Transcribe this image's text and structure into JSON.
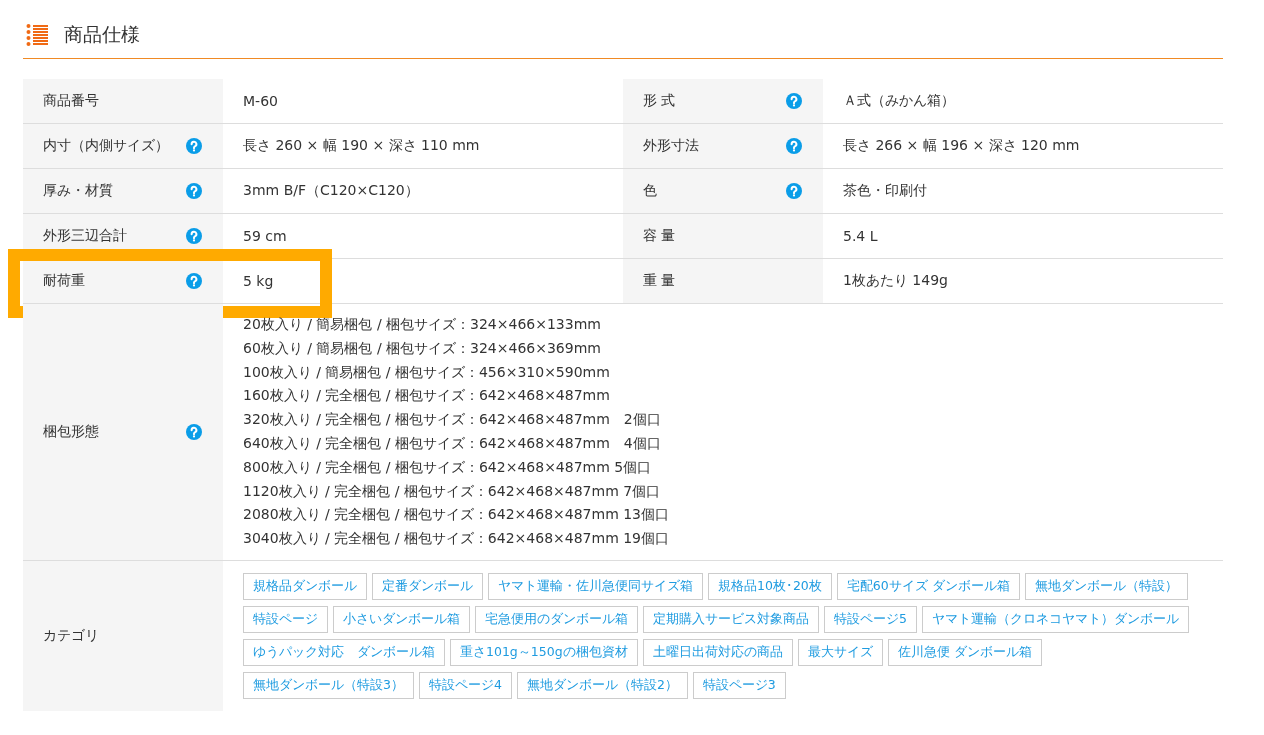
{
  "section": {
    "title": "商品仕様"
  },
  "rows": [
    {
      "cells": [
        {
          "label": "商品番号",
          "help": false,
          "value": "M-60"
        },
        {
          "label": "形 式",
          "help": true,
          "value": "Ａ式（みかん箱）"
        }
      ]
    },
    {
      "cells": [
        {
          "label": "内寸（内側サイズ）",
          "help": true,
          "value": "長さ 260 × 幅 190 × 深さ 110 mm"
        },
        {
          "label": "外形寸法",
          "help": true,
          "value": "長さ 266 × 幅 196 × 深さ 120 mm"
        }
      ]
    },
    {
      "cells": [
        {
          "label": "厚み・材質",
          "help": true,
          "value": "3mm B/F（C120×C120）"
        },
        {
          "label": "色",
          "help": true,
          "value": "茶色・印刷付"
        }
      ]
    },
    {
      "cells": [
        {
          "label": "外形三辺合計",
          "help": true,
          "value": "59 cm"
        },
        {
          "label": "容 量",
          "help": false,
          "value": "5.4 L"
        }
      ]
    },
    {
      "highlighted": true,
      "cells": [
        {
          "label": "耐荷重",
          "help": true,
          "value": "5 kg"
        },
        {
          "label": "重 量",
          "help": false,
          "value": "1枚あたり 149g"
        }
      ]
    }
  ],
  "packing": {
    "label": "梱包形態",
    "help": true,
    "lines": [
      "20枚入り / 簡易梱包 / 梱包サイズ：324×466×133mm",
      "60枚入り / 簡易梱包 / 梱包サイズ：324×466×369mm",
      "100枚入り / 簡易梱包 / 梱包サイズ：456×310×590mm",
      "160枚入り / 完全梱包 / 梱包サイズ：642×468×487mm",
      "320枚入り / 完全梱包 / 梱包サイズ：642×468×487mm　2個口",
      "640枚入り / 完全梱包 / 梱包サイズ：642×468×487mm　4個口",
      "800枚入り / 完全梱包 / 梱包サイズ：642×468×487mm 5個口",
      "1120枚入り / 完全梱包 / 梱包サイズ：642×468×487mm 7個口",
      "2080枚入り / 完全梱包 / 梱包サイズ：642×468×487mm 13個口",
      "3040枚入り / 完全梱包 / 梱包サイズ：642×468×487mm 19個口"
    ]
  },
  "category": {
    "label": "カテゴリ",
    "tags": [
      [
        "規格品ダンボール",
        "定番ダンボール",
        "ヤマト運輸・佐川急便同サイズ箱",
        "規格品10枚･20枚",
        "宅配60サイズ ダンボール箱",
        "無地ダンボール（特設）"
      ],
      [
        "特設ページ",
        "小さいダンボール箱",
        "宅急便用のダンボール箱",
        "定期購入サービス対象商品",
        "特設ページ5",
        "ヤマト運輸（クロネコヤマト）ダンボール"
      ],
      [
        "ゆうパック対応　ダンボール箱",
        "重さ101g～150gの梱包資材",
        "土曜日出荷対応の商品",
        "最大サイズ",
        "佐川急便 ダンボール箱"
      ],
      [
        "無地ダンボール（特設3）",
        "特設ページ4",
        "無地ダンボール（特設2）",
        "特設ページ3"
      ]
    ]
  }
}
